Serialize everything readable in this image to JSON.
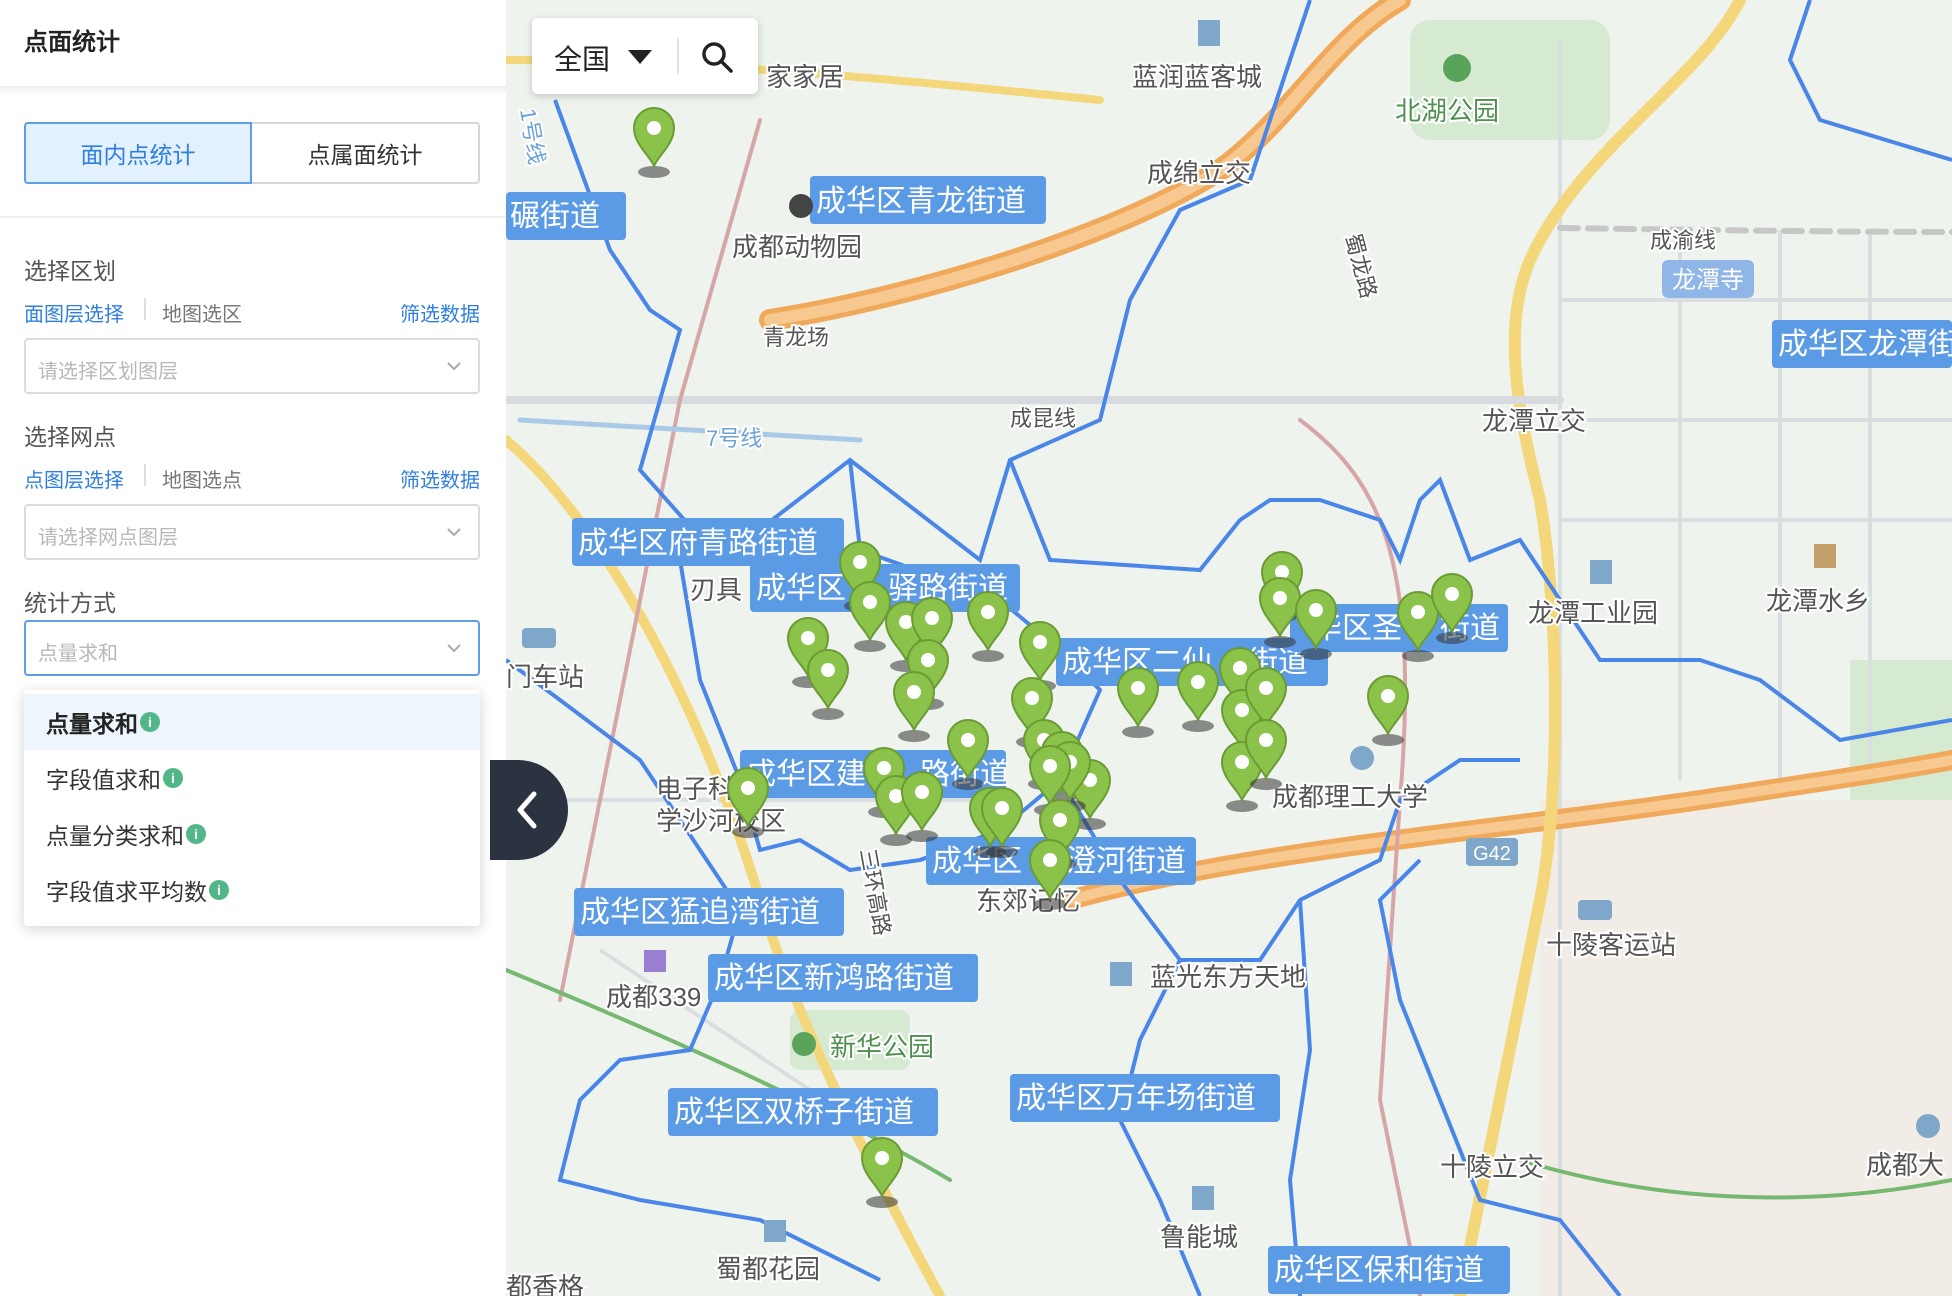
{
  "panel": {
    "title": "点面统计",
    "tabs": [
      {
        "label": "面内点统计",
        "active": true
      },
      {
        "label": "点属面统计",
        "active": false
      }
    ],
    "region": {
      "label": "选择区划",
      "layer_select": "面图层选择",
      "map_select": "地图选区",
      "filter": "筛选数据",
      "placeholder": "请选择区划图层"
    },
    "outlet": {
      "label": "选择网点",
      "layer_select": "点图层选择",
      "map_select": "地图选点",
      "filter": "筛选数据",
      "placeholder": "请选择网点图层"
    },
    "method": {
      "label": "统计方式",
      "placeholder": "点量求和",
      "options": [
        "点量求和",
        "字段值求和",
        "点量分类求和",
        "字段值求平均数"
      ],
      "selected": "点量求和"
    }
  },
  "map": {
    "region_selector": "全国",
    "district_labels": [
      "碾街道",
      "成华区青龙街道",
      "成华区府青路街道",
      "成华区",
      "驿路街道",
      "成华区二仙",
      "街道",
      "华区圣",
      "街道",
      "成华区建",
      "路街道",
      "成华区",
      "澄河街道",
      "成华区猛追湾街道",
      "成华区新鸿路街道",
      "成华区双桥子街道",
      "成华区万年场街道",
      "成华区保和街道",
      "成华区龙潭街"
    ],
    "place_labels": [
      "家家居",
      "蓝润蓝客城",
      "北湖公园",
      "成绵立交",
      "成都动物园",
      "青龙场",
      "成渝线",
      "龙潭寺",
      "成昆线",
      "7号线",
      "龙潭立交",
      "刃具",
      "门车站",
      "龙潭工业园",
      "龙潭水乡",
      "电子科",
      "学沙河校区",
      "成都理工大学",
      "东郊记忆",
      "G42",
      "成都339",
      "蓝光东方天地",
      "新华公园",
      "十陵客运站",
      "十陵立交",
      "成都大",
      "鲁能城",
      "蜀都花园",
      "都香格",
      "蜀龙路",
      "1号线",
      "三环高路"
    ],
    "colors": {
      "boundary": "#4a86e8",
      "label_bg": "#5b9be6",
      "marker": "#8bc34a",
      "road_orange": "#f0a95a",
      "road_yellow": "#f3d77a"
    }
  }
}
